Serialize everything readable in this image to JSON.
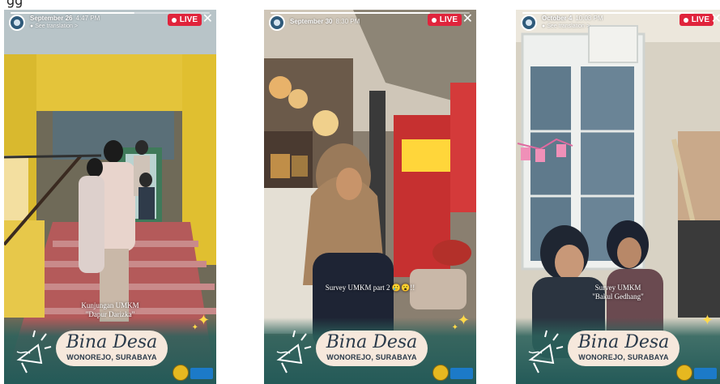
{
  "cut_text": "gg",
  "stories": [
    {
      "date": "September 26",
      "time": "4:47 PM",
      "translation": "See translation >",
      "live_label": "LIVE",
      "progress": 0.62,
      "caption_line1": "Kunjungan UMKM",
      "caption_line2": "\"Dapur Darizka\"",
      "title": "Bina Desa",
      "subtitle": "WONOREJO, SURABAYA"
    },
    {
      "date": "September 30",
      "time": "8:30 PM",
      "translation": "",
      "live_label": "LIVE",
      "progress": 0.8,
      "caption_line1": "Survey UMKM part 2",
      "caption_line2": "",
      "title": "Bina Desa",
      "subtitle": "WONOREJO, SURABAYA"
    },
    {
      "date": "October 4",
      "time": "10:03 PM",
      "translation": "See translation >",
      "live_label": "LIVE",
      "progress": 0.9,
      "caption_line1": "Survey UMKM",
      "caption_line2": "\"Bakul Gedhang\"",
      "title": "Bina Desa",
      "subtitle": "WONOREJO, SURABAYA"
    }
  ],
  "colors": {
    "live_red": "#e0243c",
    "badge_cream": "#f6e8dc",
    "teal_footer": "#245a58"
  }
}
